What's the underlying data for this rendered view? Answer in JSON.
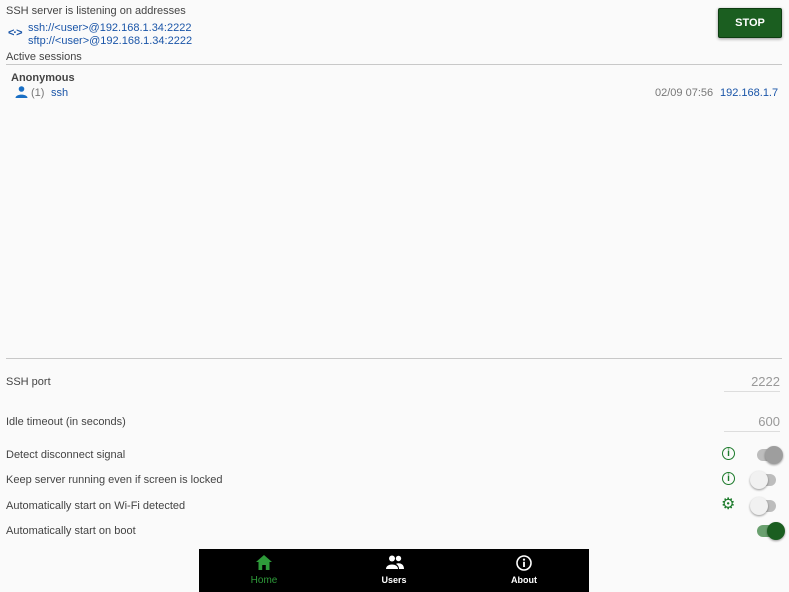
{
  "server": {
    "listening_title": "SSH server is listening on addresses",
    "addresses": [
      "ssh://<user>@192.168.1.34:2222",
      "sftp://<user>@192.168.1.34:2222"
    ],
    "stop_label": "STOP"
  },
  "sessions": {
    "title": "Active sessions",
    "items": [
      {
        "user": "Anonymous",
        "count": "(1)",
        "protocol": "ssh",
        "time": "02/09 07:56",
        "ip": "192.168.1.7"
      }
    ]
  },
  "settings": {
    "ssh_port_label": "SSH port",
    "ssh_port_value": "2222",
    "idle_timeout_label": "Idle timeout (in seconds)",
    "idle_timeout_value": "600",
    "detect_disconnect_label": "Detect disconnect signal",
    "detect_disconnect_on": false,
    "keep_running_label": "Keep server running even if screen is locked",
    "keep_running_on": false,
    "auto_wifi_label": "Automatically start on Wi-Fi detected",
    "auto_wifi_on": false,
    "auto_boot_label": "Automatically start on boot",
    "auto_boot_on": true
  },
  "nav": {
    "home": "Home",
    "users": "Users",
    "about": "About",
    "active": "home"
  },
  "colors": {
    "accent": "#1b5e20",
    "link": "#1a55a8",
    "nav_active": "#2e9b3a"
  }
}
